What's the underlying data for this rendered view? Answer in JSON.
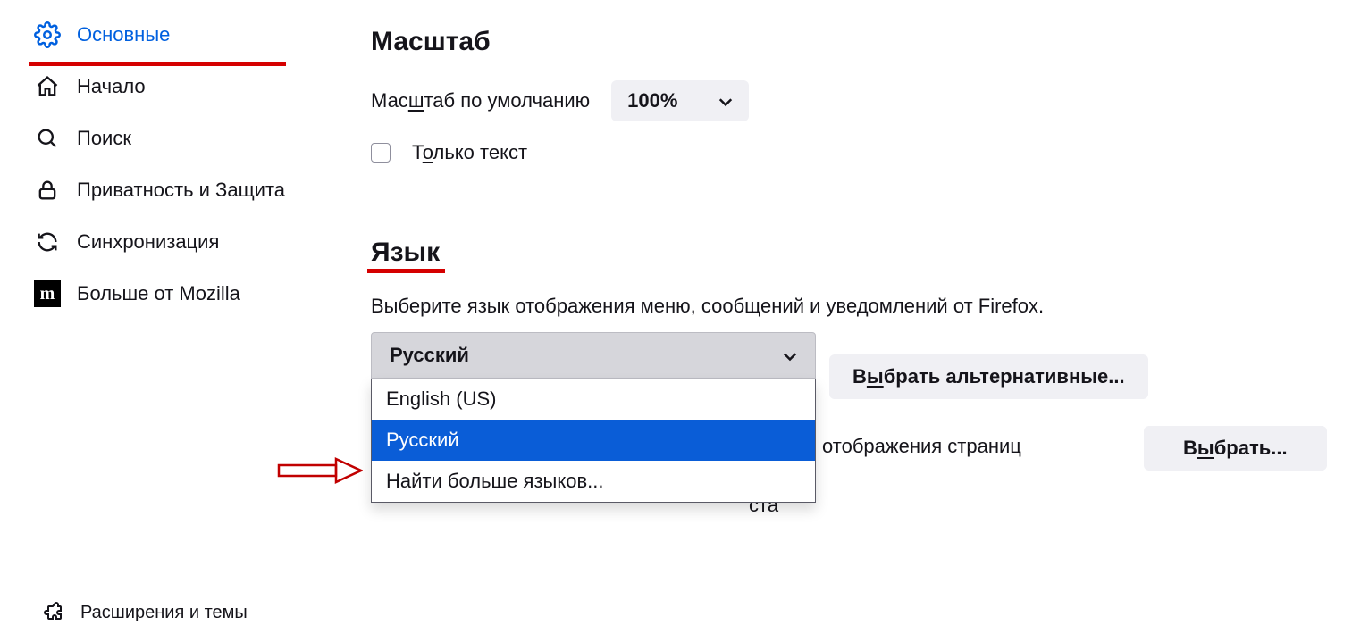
{
  "sidebar": {
    "items": [
      {
        "label": "Основные"
      },
      {
        "label": "Начало"
      },
      {
        "label": "Поиск"
      },
      {
        "label": "Приватность и Защита"
      },
      {
        "label": "Синхронизация"
      },
      {
        "label": "Больше от Mozilla"
      }
    ],
    "footer": {
      "label": "Расширения и темы"
    }
  },
  "zoom": {
    "heading": "Масштаб",
    "default_label_before": "Мас",
    "default_label_accel": "ш",
    "default_label_after": "таб по умолчанию",
    "value": "100%",
    "text_only_before": "Т",
    "text_only_accel": "о",
    "text_only_after": "лько текст"
  },
  "language": {
    "heading": "Язык",
    "description": "Выберите язык отображения меню, сообщений и уведомлений от Firefox.",
    "selected": "Русский",
    "options": [
      "English (US)",
      "Русский",
      "Найти больше языков..."
    ],
    "alt_button_before": "В",
    "alt_button_accel": "ы",
    "alt_button_after": "брать альтернативные...",
    "pages_label_fragment": "отображения страниц",
    "choose_button_before": "В",
    "choose_button_accel": "ы",
    "choose_button_after": "брать...",
    "text_fragment": "ста"
  },
  "colors": {
    "accent": "#0060df",
    "annotation": "#d50000",
    "select_highlight": "#0a5dd7"
  }
}
